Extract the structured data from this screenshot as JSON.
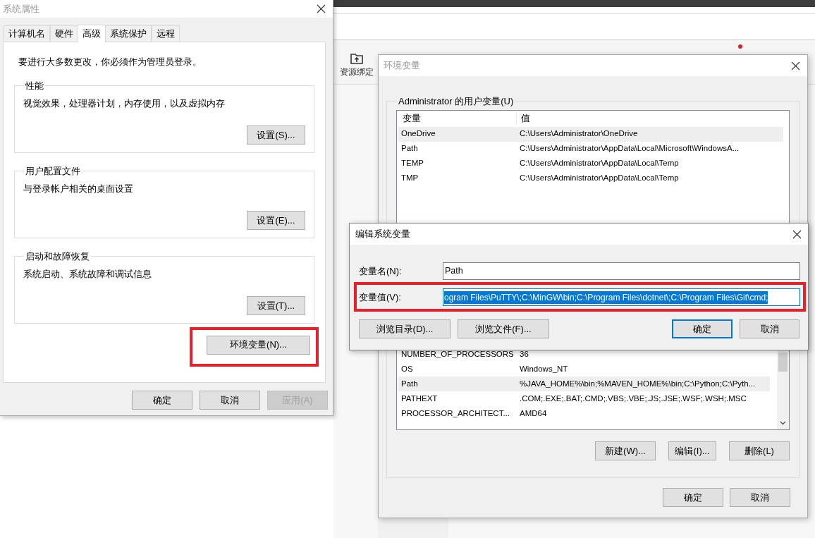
{
  "background_app": {
    "toolbar_item": "资源绑定"
  },
  "system_properties": {
    "title": "系统属性",
    "active": false,
    "tabs": [
      {
        "label": "计算机名",
        "selected": false
      },
      {
        "label": "硬件",
        "selected": false
      },
      {
        "label": "高级",
        "selected": true
      },
      {
        "label": "系统保护",
        "selected": false
      },
      {
        "label": "远程",
        "selected": false
      }
    ],
    "notice": "要进行大多数更改，你必须作为管理员登录。",
    "groups": [
      {
        "title": "性能",
        "description": "视觉效果，处理器计划，内存使用，以及虚拟内存",
        "button": "设置(S)..."
      },
      {
        "title": "用户配置文件",
        "description": "与登录帐户相关的桌面设置",
        "button": "设置(E)..."
      },
      {
        "title": "启动和故障恢复",
        "description": "系统启动、系统故障和调试信息",
        "button": "设置(T)..."
      }
    ],
    "env_button": {
      "label": "环境变量(N)...",
      "highlighted": true
    },
    "buttons": [
      {
        "label": "确定",
        "disabled": false
      },
      {
        "label": "取消",
        "disabled": false
      },
      {
        "label": "应用(A)",
        "disabled": true
      }
    ]
  },
  "environment_variables": {
    "title": "环境变量",
    "active": false,
    "user_group_title": "Administrator 的用户变量(U)",
    "user_columns": [
      "变量",
      "值"
    ],
    "user_rows": [
      {
        "name": "OneDrive",
        "value": "C:\\Users\\Administrator\\OneDrive",
        "selected": true
      },
      {
        "name": "Path",
        "value": "C:\\Users\\Administrator\\AppData\\Local\\Microsoft\\WindowsA...",
        "selected": false
      },
      {
        "name": "TEMP",
        "value": "C:\\Users\\Administrator\\AppData\\Local\\Temp",
        "selected": false
      },
      {
        "name": "TMP",
        "value": "C:\\Users\\Administrator\\AppData\\Local\\Temp",
        "selected": false
      }
    ],
    "system_rows": [
      {
        "name": "NUMBER_OF_PROCESSORS",
        "value": "36",
        "selected": false
      },
      {
        "name": "OS",
        "value": "Windows_NT",
        "selected": false
      },
      {
        "name": "Path",
        "value": "%JAVA_HOME%\\bin;%MAVEN_HOME%\\bin;C:\\Python;C:\\Pyth...",
        "selected": true
      },
      {
        "name": "PATHEXT",
        "value": ".COM;.EXE;.BAT;.CMD;.VBS;.VBE;.JS;.JSE;.WSF;.WSH;.MSC",
        "selected": false
      },
      {
        "name": "PROCESSOR_ARCHITECT...",
        "value": "AMD64",
        "selected": false
      }
    ],
    "system_buttons": [
      "新建(W)...",
      "编辑(I)...",
      "删除(L)"
    ],
    "buttons": [
      "确定",
      "取消"
    ]
  },
  "edit_dialog": {
    "title": "编辑系统变量",
    "active": true,
    "name_label": "变量名(N):",
    "name_value": "Path",
    "value_label": "变量值(V):",
    "value_value": "ogram Files\\PuTTY\\;C:\\MinGW\\bin;C:\\Program Files\\dotnet\\;C:\\Program Files\\Git\\cmd;",
    "value_selected": true,
    "value_highlighted": true,
    "browse_buttons": [
      "浏览目录(D)...",
      "浏览文件(F)..."
    ],
    "buttons": [
      {
        "label": "确定",
        "default": true
      },
      {
        "label": "取消",
        "default": false
      }
    ]
  }
}
